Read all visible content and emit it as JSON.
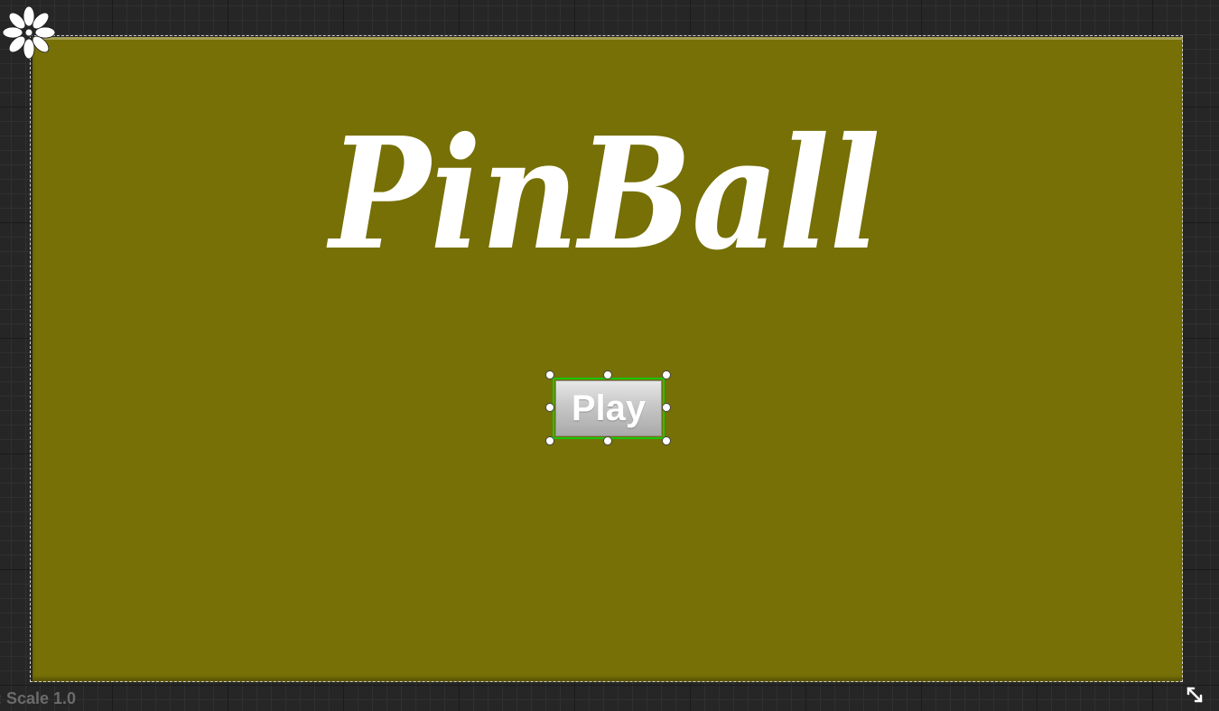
{
  "canvas": {
    "background_color": "#767006",
    "logo_text": "PinBall"
  },
  "play_button": {
    "label": "Play"
  },
  "selection": {
    "outline_color": "#19c60c"
  },
  "footer": {
    "dpi_scale_text": ": Scale 1.0"
  },
  "icons": {
    "anchor": "anchor-flower-icon",
    "resize": "resize-diagonal-icon"
  }
}
